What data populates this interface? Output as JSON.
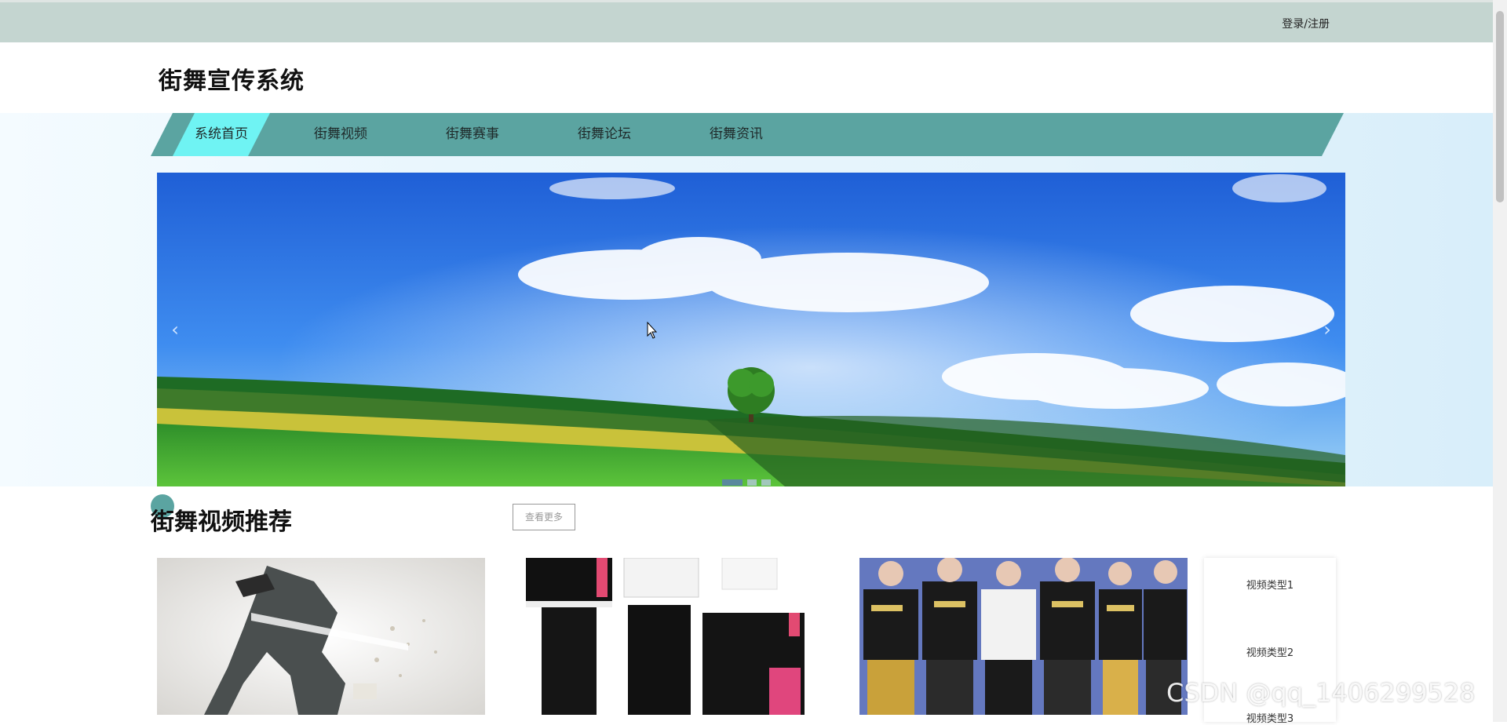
{
  "topbar": {
    "login_label": "登录/注册"
  },
  "brand": {
    "title": "街舞宣传系统"
  },
  "nav": {
    "items": [
      {
        "label": "系统首页",
        "active": true
      },
      {
        "label": "街舞视频",
        "active": false
      },
      {
        "label": "街舞赛事",
        "active": false
      },
      {
        "label": "街舞论坛",
        "active": false
      },
      {
        "label": "街舞资讯",
        "active": false
      }
    ]
  },
  "carousel": {
    "prev_icon": "chevron-left-icon",
    "next_icon": "chevron-right-icon",
    "prev_glyph": "‹",
    "next_glyph": "›",
    "slide_count": 3,
    "active_slide": 1
  },
  "video_section": {
    "title": "街舞视频推荐",
    "more_label": "查看更多",
    "types": [
      "视频类型1",
      "视频类型2",
      "视频类型3"
    ]
  },
  "watermark": "CSDN @qq_1406299528",
  "colors": {
    "topbar": "#c4d5d0",
    "nav": "#5ba4a1",
    "nav_active": "#6ff3f3",
    "accent": "#5ba4a1"
  }
}
